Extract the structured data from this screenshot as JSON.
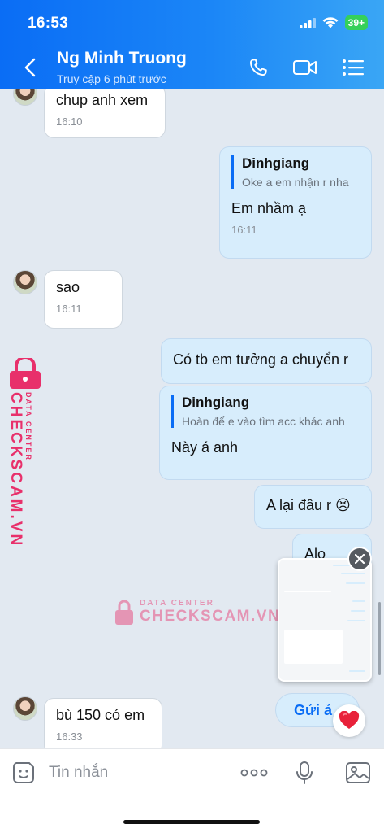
{
  "status_bar": {
    "time": "16:53",
    "battery": "39+"
  },
  "header": {
    "contact_name": "Ng Minh Truong",
    "contact_status": "Truy cập 6 phút trước"
  },
  "messages": [
    {
      "id": "m1",
      "text": "chup anh xem",
      "time": "16:10"
    },
    {
      "id": "m2",
      "quote_name": "Dinhgiang",
      "quote_text": "Oke a em nhận r nha",
      "text": "Em nhầm ạ",
      "time": "16:11"
    },
    {
      "id": "m3",
      "text": "sao",
      "time": "16:11"
    },
    {
      "id": "m4",
      "text": "Có tb em tưởng a chuyển r"
    },
    {
      "id": "m5",
      "quote_name": "Dinhgiang",
      "quote_text": "Hoàn để e vào tìm acc khác anh",
      "text": "Này á anh"
    },
    {
      "id": "m6",
      "text": "A lại đâu r 😣"
    },
    {
      "id": "m7",
      "text": "Alo"
    },
    {
      "id": "m8",
      "text": "bù 150 có em",
      "time": "16:33"
    }
  ],
  "watermark": {
    "brand": "CHECKSCAM.VN",
    "sub": "DATA CENTER",
    "center_title": "DATA CENTER",
    "center_name": "CHECKSCAM.VN"
  },
  "send_image_label": "Gửi ả",
  "input": {
    "placeholder": "Tin nhắn"
  },
  "icons": {
    "back": "chevron-left-icon",
    "call": "phone-icon",
    "video": "video-icon",
    "menu": "list-icon",
    "sticker": "sticker-icon",
    "more": "more-dots-icon",
    "mic": "mic-icon",
    "image": "image-icon",
    "close": "close-icon",
    "heart": "heart-icon"
  },
  "colors": {
    "header_start": "#0a6df5",
    "header_end": "#3aa6f5",
    "outgoing_bubble": "#d7edfc",
    "incoming_bubble": "#ffffff",
    "watermark": "#e8306b",
    "chat_bg": "#e2e9f1"
  }
}
